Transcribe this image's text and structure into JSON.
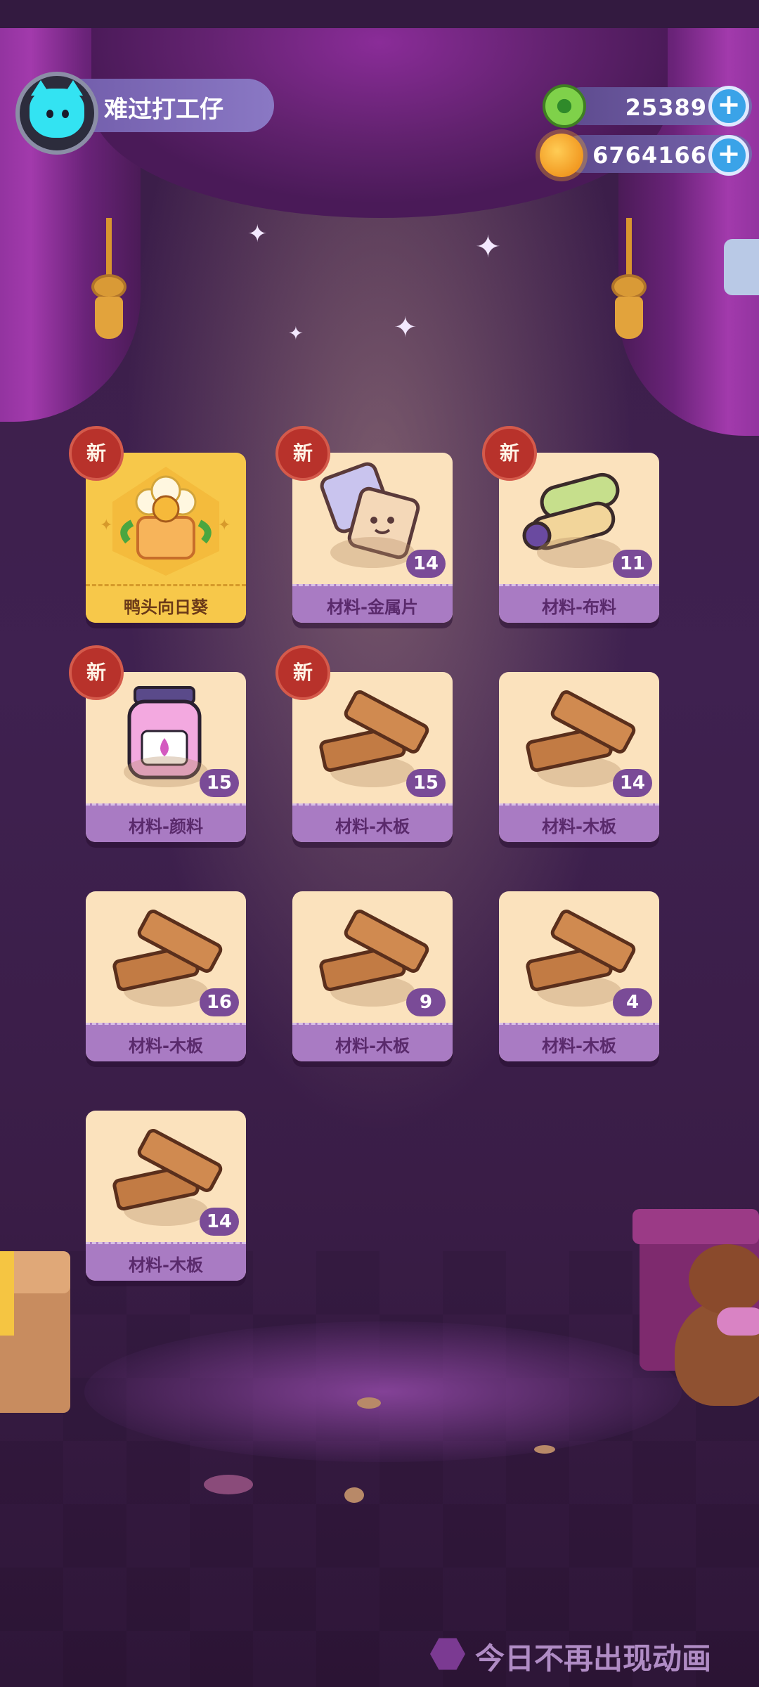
{
  "profile": {
    "name": "难过打工仔",
    "avatar": "cat-avatar"
  },
  "currency": [
    {
      "icon": "green-donut-coin",
      "value": "25389",
      "plus": "+"
    },
    {
      "icon": "orange-planet-coin",
      "value": "6764166",
      "plus": "+"
    }
  ],
  "rewards": [
    {
      "label": "鸭头向日葵",
      "qty": "",
      "new": "新",
      "art": "duck-sunflower",
      "gold": true
    },
    {
      "label": "材料-金属片",
      "qty": "14",
      "new": "新",
      "art": "metal-sheet"
    },
    {
      "label": "材料-布料",
      "qty": "11",
      "new": "新",
      "art": "fabric-rolls"
    },
    {
      "label": "材料-颜料",
      "qty": "15",
      "new": "新",
      "art": "paint-jar"
    },
    {
      "label": "材料-木板",
      "qty": "15",
      "new": "新",
      "art": "wood-planks"
    },
    {
      "label": "材料-木板",
      "qty": "14",
      "new": "",
      "art": "wood-planks"
    },
    {
      "label": "材料-木板",
      "qty": "16",
      "new": "",
      "art": "wood-planks"
    },
    {
      "label": "材料-木板",
      "qty": "9",
      "new": "",
      "art": "wood-planks"
    },
    {
      "label": "材料-木板",
      "qty": "4",
      "new": "",
      "art": "wood-planks"
    },
    {
      "label": "材料-木板",
      "qty": "14",
      "new": "",
      "art": "wood-planks"
    }
  ],
  "footer": {
    "skip_animation_label": "今日不再出现动画"
  },
  "colors": {
    "card_bg": "#fbe2bd",
    "label_bar": "#a97bc3",
    "new_badge": "#b8322b",
    "gold_card": "#f7c84a"
  }
}
